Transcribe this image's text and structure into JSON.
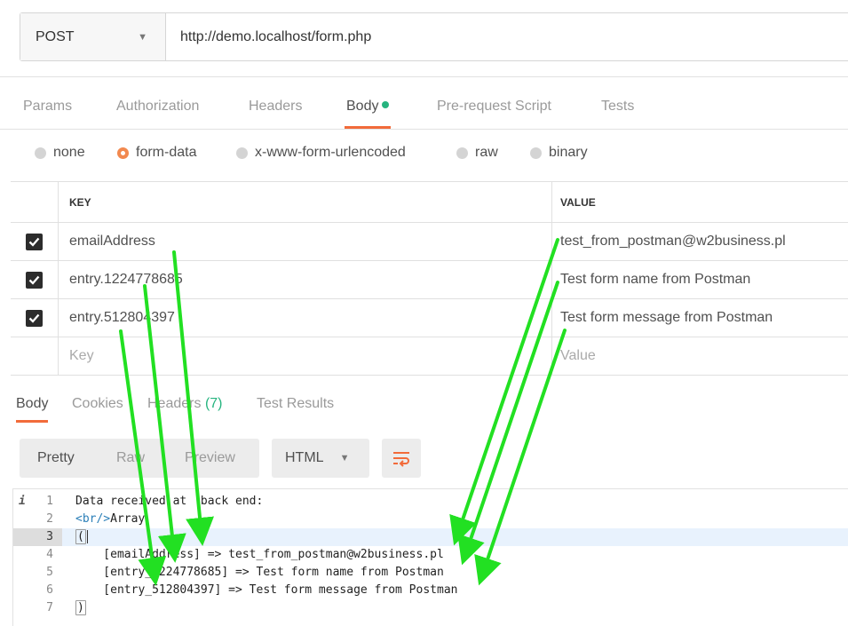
{
  "request": {
    "method": "POST",
    "url": "http://demo.localhost/form.php"
  },
  "request_tabs": [
    {
      "label": "Params"
    },
    {
      "label": "Authorization"
    },
    {
      "label": "Headers"
    },
    {
      "label": "Body",
      "active": true
    },
    {
      "label": "Pre-request Script"
    },
    {
      "label": "Tests"
    }
  ],
  "body_types": [
    {
      "label": "none"
    },
    {
      "label": "form-data",
      "selected": true
    },
    {
      "label": "x-www-form-urlencoded"
    },
    {
      "label": "raw"
    },
    {
      "label": "binary"
    }
  ],
  "form_table": {
    "key_header": "KEY",
    "value_header": "VALUE",
    "rows": [
      {
        "key": "emailAddress",
        "value": "test_from_postman@w2business.pl",
        "checked": true
      },
      {
        "key": "entry.1224778685",
        "value": "Test form name from Postman",
        "checked": true
      },
      {
        "key": "entry.512804397",
        "value": "Test form message from Postman",
        "checked": true
      }
    ],
    "key_placeholder": "Key",
    "value_placeholder": "Value"
  },
  "response_tabs": [
    {
      "label": "Body",
      "active": true
    },
    {
      "label": "Cookies"
    },
    {
      "label": "Headers",
      "count": "(7)"
    },
    {
      "label": "Test Results"
    }
  ],
  "view_modes": [
    "Pretty",
    "Raw",
    "Preview"
  ],
  "active_view_mode": "Pretty",
  "format": "HTML",
  "icons": {
    "method_caret": "chevron-down-icon",
    "format_caret": "chevron-down-icon",
    "wrap": "wrap-lines-icon",
    "info": "info-icon",
    "check": "checkmark-icon"
  },
  "colors": {
    "accent": "#f26b3a",
    "active_dot": "#26b47f",
    "annotation_arrow": "#22e022",
    "highlight_line": "#e8f2fd"
  },
  "response_body": {
    "info_marker": "i",
    "lines": [
      {
        "n": "1",
        "text": "Data received at  back end:"
      },
      {
        "n": "2",
        "tag": "<br/>",
        "text": "Array"
      },
      {
        "n": "3",
        "text": "(",
        "current": true
      },
      {
        "n": "4",
        "text": "    [emailAddress] => test_from_postman@w2business.pl"
      },
      {
        "n": "5",
        "text": "    [entry_1224778685] => Test form name from Postman"
      },
      {
        "n": "6",
        "text": "    [entry_512804397] => Test form message from Postman"
      },
      {
        "n": "7",
        "text": ")"
      }
    ]
  }
}
